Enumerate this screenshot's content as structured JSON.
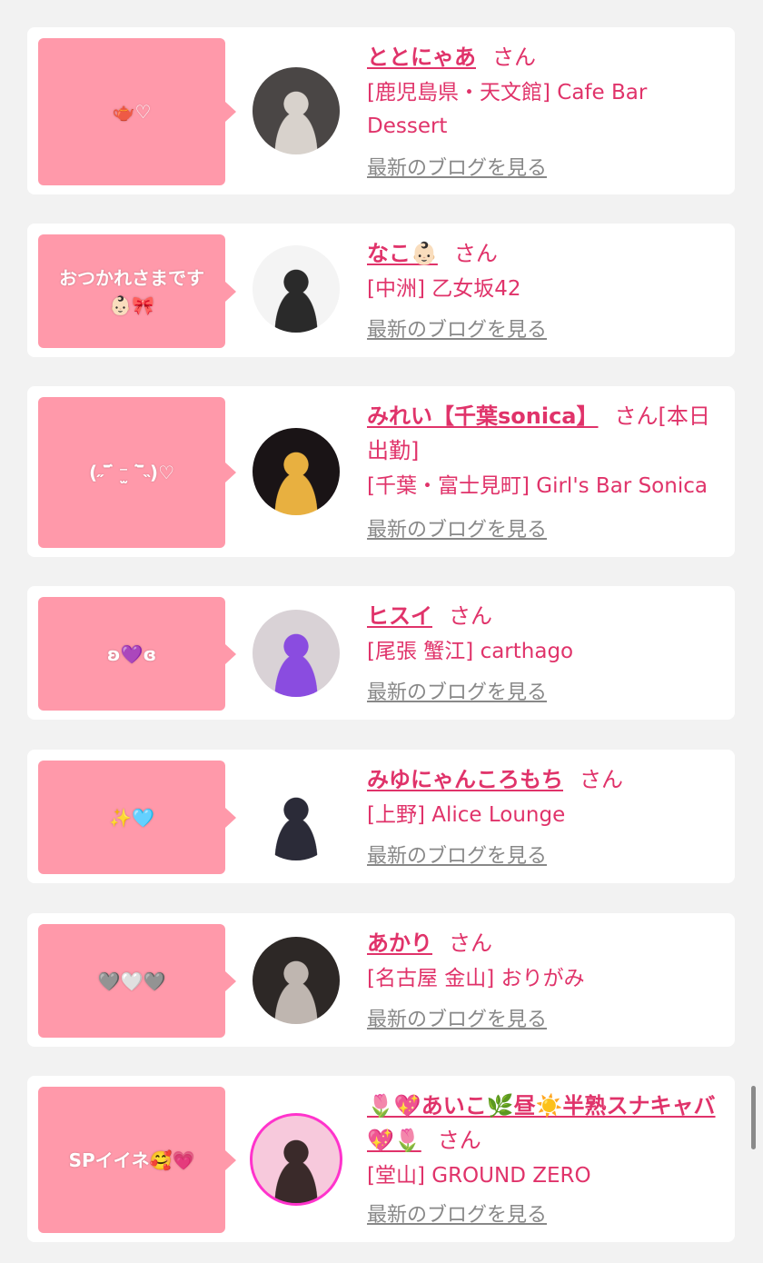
{
  "suffix_san": "さん",
  "blog_link_label": "最新のブログを見る",
  "colors": {
    "page_bg": "#f2f2f2",
    "card_bg": "#ffffff",
    "bubble_bg": "#ff99aa",
    "name_color": "#e0336a",
    "link_gray": "#888888"
  },
  "entries": [
    {
      "bubble": "🫖♡",
      "name": "ととにゃあ",
      "suffix": "さん",
      "shop": "[鹿児島県・天文館] Cafe Bar Dessert",
      "avatar": {
        "bg": "#4a4645",
        "accent": "#d8d2cc"
      }
    },
    {
      "bubble": "おつかれさまです\n👶🏻🎀",
      "name": "なこ👶🏻",
      "suffix": "さん",
      "shop": "[中洲] 乙女坂42",
      "avatar": {
        "bg": "#f4f4f4",
        "accent": "#2a2a2a"
      }
    },
    {
      "bubble": "(˶‾᷄ ⁻̫ ‾᷅˵)♡",
      "name": "みれい【千葉sonica】",
      "suffix": "さん[本日出勤]",
      "shop": "[千葉・富士見町] Girl's Bar Sonica",
      "avatar": {
        "bg": "#1a1416",
        "accent": "#e8b040"
      }
    },
    {
      "bubble": "ʚ💜ɞ",
      "name": "ヒスイ",
      "suffix": "さん",
      "shop": "[尾張 蟹江] carthago",
      "avatar": {
        "bg": "#d9d2d6",
        "accent": "#8a4ce0"
      }
    },
    {
      "bubble": "✨🩵",
      "name": "みゆにゃんころもち",
      "suffix": "さん",
      "shop": "[上野] Alice Lounge",
      "avatar": {
        "bg": "#ffffff",
        "accent": "#2b2b38"
      }
    },
    {
      "bubble": "🩶🤍🩶",
      "name": "あかり",
      "suffix": "さん",
      "shop": "[名古屋 金山] おりがみ",
      "avatar": {
        "bg": "#2d2826",
        "accent": "#bfb6b0"
      }
    },
    {
      "bubble": "SPイイネ🥰💗",
      "name": "🌷💖あいこ🌿昼☀️半熟スナキャバ💖🌷",
      "suffix": "さん",
      "shop": "[堂山] GROUND ZERO",
      "avatar": {
        "bg": "#f7c9dc",
        "accent": "#3a2a2a"
      }
    }
  ]
}
